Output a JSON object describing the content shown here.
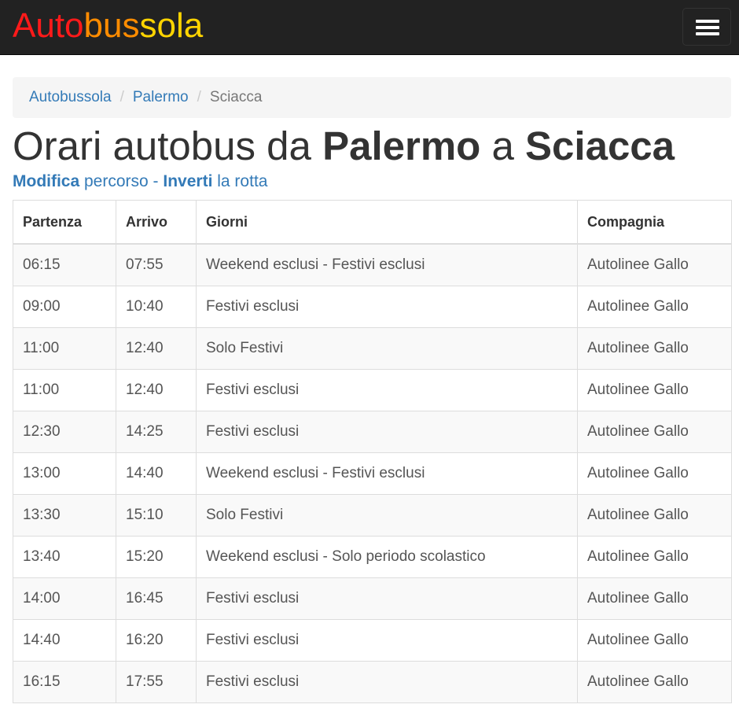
{
  "brand": {
    "parts": [
      {
        "text": "Auto",
        "color": "#ff1a1a"
      },
      {
        "text": "bus",
        "color": "#ff8c00"
      },
      {
        "text": "sola",
        "color": "#ffd400"
      }
    ]
  },
  "navbar": {
    "menu_icon": "hamburger-menu-icon"
  },
  "breadcrumb": {
    "items": [
      {
        "label": "Autobussola"
      },
      {
        "label": "Palermo"
      },
      {
        "label": "Sciacca"
      }
    ],
    "separator": "/"
  },
  "title": {
    "prefix": "Orari autobus da ",
    "from": "Palermo",
    "middle": " a ",
    "to": "Sciacca"
  },
  "subnav": {
    "modify_bold": "Modifica",
    "modify_rest": " percorso",
    "dash": " - ",
    "invert_bold": "Inverti",
    "invert_rest": " la rotta"
  },
  "table": {
    "headers": [
      "Partenza",
      "Arrivo",
      "Giorni",
      "Compagnia"
    ],
    "rows": [
      [
        "06:15",
        "07:55",
        "Weekend esclusi - Festivi esclusi",
        "Autolinee Gallo"
      ],
      [
        "09:00",
        "10:40",
        "Festivi esclusi",
        "Autolinee Gallo"
      ],
      [
        "11:00",
        "12:40",
        "Solo Festivi",
        "Autolinee Gallo"
      ],
      [
        "11:00",
        "12:40",
        "Festivi esclusi",
        "Autolinee Gallo"
      ],
      [
        "12:30",
        "14:25",
        "Festivi esclusi",
        "Autolinee Gallo"
      ],
      [
        "13:00",
        "14:40",
        "Weekend esclusi - Festivi esclusi",
        "Autolinee Gallo"
      ],
      [
        "13:30",
        "15:10",
        "Solo Festivi",
        "Autolinee Gallo"
      ],
      [
        "13:40",
        "15:20",
        "Weekend esclusi - Solo periodo scolastico",
        "Autolinee Gallo"
      ],
      [
        "14:00",
        "16:45",
        "Festivi esclusi",
        "Autolinee Gallo"
      ],
      [
        "14:40",
        "16:20",
        "Festivi esclusi",
        "Autolinee Gallo"
      ],
      [
        "16:15",
        "17:55",
        "Festivi esclusi",
        "Autolinee Gallo"
      ]
    ]
  }
}
